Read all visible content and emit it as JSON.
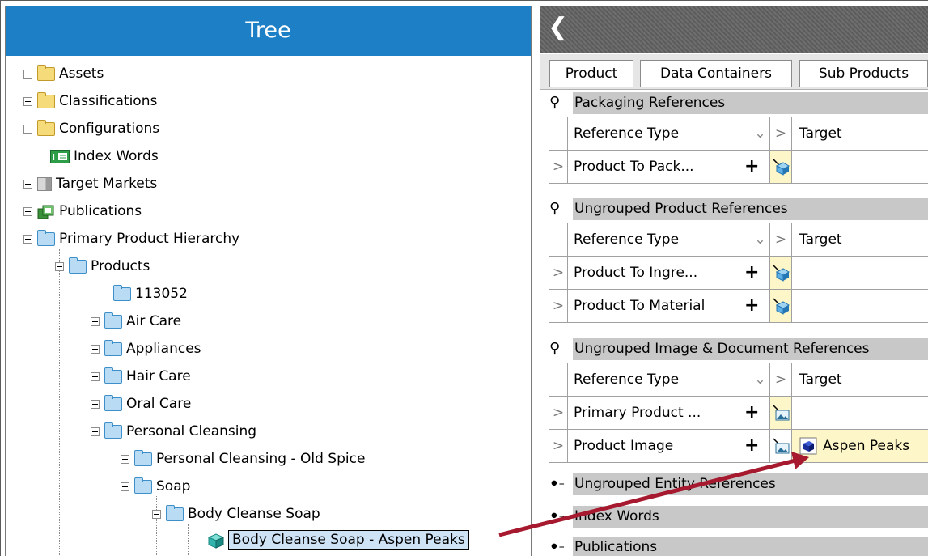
{
  "tree": {
    "title": "Tree",
    "nodes": [
      {
        "label": "Assets"
      },
      {
        "label": "Classifications"
      },
      {
        "label": "Configurations"
      },
      {
        "label": "Index Words"
      },
      {
        "label": "Target Markets"
      },
      {
        "label": "Publications"
      },
      {
        "label": "Primary Product Hierarchy"
      },
      {
        "label": "Products"
      },
      {
        "label": "113052"
      },
      {
        "label": "Air Care"
      },
      {
        "label": "Appliances"
      },
      {
        "label": "Hair Care"
      },
      {
        "label": "Oral Care"
      },
      {
        "label": "Personal Cleansing"
      },
      {
        "label": "Personal Cleansing - Old Spice"
      },
      {
        "label": "Soap"
      },
      {
        "label": "Body Cleanse Soap"
      },
      {
        "label": "Body Cleanse Soap - Aspen Peaks"
      }
    ]
  },
  "editor": {
    "collapse_icon": "chevron-left-icon",
    "tabs": [
      "Product",
      "Data Containers",
      "Sub Products"
    ],
    "groups": [
      {
        "title": "Packaging References",
        "col_reference_type": "Reference Type",
        "col_target": "Target",
        "rows": [
          {
            "type": "Product To Pack...",
            "target": ""
          }
        ]
      },
      {
        "title": "Ungrouped Product References",
        "col_reference_type": "Reference Type",
        "col_target": "Target",
        "rows": [
          {
            "type": "Product To Ingre...",
            "target": ""
          },
          {
            "type": "Product To Material",
            "target": ""
          }
        ]
      },
      {
        "title": "Ungrouped Image & Document References",
        "col_reference_type": "Reference Type",
        "col_target": "Target",
        "rows": [
          {
            "type": "Primary Product ...",
            "target": ""
          },
          {
            "type": "Product Image",
            "target": "Aspen Peaks"
          }
        ]
      }
    ],
    "collapsed_groups": [
      "Ungrouped Entity References",
      "Index Words",
      "Publications"
    ]
  },
  "colors": {
    "tree_header": "#1d80c6",
    "arrow": "#a6192e",
    "target_highlight": "#fdf6c8"
  }
}
